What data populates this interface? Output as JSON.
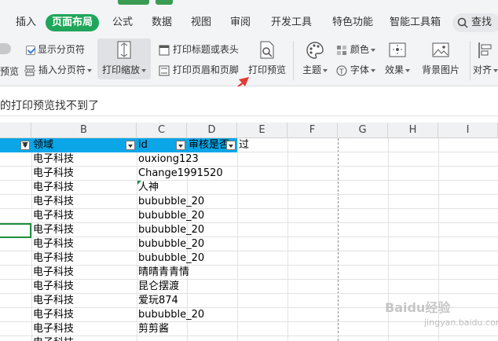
{
  "menu": {
    "tabs": [
      {
        "label": "插入",
        "active": false
      },
      {
        "label": "页面布局",
        "active": true
      },
      {
        "label": "公式",
        "active": false
      },
      {
        "label": "数据",
        "active": false
      },
      {
        "label": "视图",
        "active": false
      },
      {
        "label": "审阅",
        "active": false
      },
      {
        "label": "开发工具",
        "active": false
      },
      {
        "label": "特色功能",
        "active": false
      },
      {
        "label": "智能工具箱",
        "active": false
      }
    ],
    "search_label": "查找"
  },
  "ribbon": {
    "preview_partial": "预览",
    "show_page_breaks": "显示分页符",
    "insert_page_break": "插入分页符",
    "print_scale": "打印缩放",
    "print_titles": "打印标题或表头",
    "print_header_footer": "打印页眉和页脚",
    "print_preview": "打印预览",
    "theme": "主题",
    "colors": "颜色",
    "fonts": "字体",
    "effects": "效果",
    "background": "背景图片",
    "align": "对齐"
  },
  "title_text": "的打印预览找不到了",
  "columns": [
    "",
    "B",
    "C",
    "D",
    "E",
    "F",
    "G",
    "H",
    "I"
  ],
  "header_row": {
    "domain": "领域",
    "id": "id",
    "review": "审核是否",
    "overflow": "过"
  },
  "rows": [
    {
      "domain": "电子科技",
      "id": "ouxiong123"
    },
    {
      "domain": "电子科技",
      "id": "Change1991520"
    },
    {
      "domain": "电子科技",
      "id": "人神"
    },
    {
      "domain": "电子科技",
      "id": "bububble_20"
    },
    {
      "domain": "电子科技",
      "id": "bububble_20"
    },
    {
      "domain": "电子科技",
      "id": "bububble_20"
    },
    {
      "domain": "电子科技",
      "id": "bububble_20"
    },
    {
      "domain": "电子科技",
      "id": "bububble_20"
    },
    {
      "domain": "电子科技",
      "id": "晴晴青青情"
    },
    {
      "domain": "电子科技",
      "id": "昆仑摆渡"
    },
    {
      "domain": "电子科技",
      "id": "爱玩874"
    },
    {
      "domain": "电子科技",
      "id": "bububble_20"
    },
    {
      "domain": "电子科技",
      "id": "剪剪酱"
    },
    {
      "domain": "电子科技",
      "id": ""
    }
  ],
  "watermark": {
    "main": "Baidu经验",
    "sub": "jingyan.baidu.com"
  },
  "colors": {
    "active_tab": "#1fa65a",
    "header_fill": "#0aa6e8",
    "selection": "#1e8e3e",
    "arrow": "#e53935"
  }
}
